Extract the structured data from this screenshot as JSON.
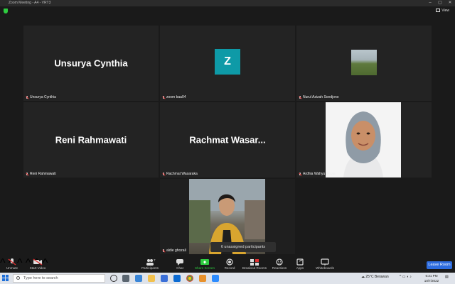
{
  "window": {
    "title": "Zoom Meeting - A4 - VRT3"
  },
  "view_label": "View",
  "tiles": [
    {
      "big_name": "Unsurya Cynthia",
      "label": "Unsurya Cynthia"
    },
    {
      "avatar_letter": "Z",
      "label": "zoom baa04"
    },
    {
      "label": "Nurul Azizah Soedjono"
    },
    {
      "big_name": "Reni Rahmawati",
      "label": "Reni Rahmawati"
    },
    {
      "big_name": "Rachmat  Wasar...",
      "label": "Rachmat Wasaraka"
    },
    {
      "label": "Ardhia Wahyu Septa"
    },
    {
      "label": "aldie ghozali"
    }
  ],
  "unassigned": "6 unassigned participants",
  "toolbar": {
    "unmute": "Unmute",
    "start_video": "Start Video",
    "participants": "Participants",
    "participants_count": "7",
    "chat": "Chat",
    "share_screen": "Share Screen",
    "record": "Record",
    "breakout_rooms": "Breakout Rooms",
    "reactions": "Reactions",
    "apps": "Apps",
    "whiteboards": "Whiteboards",
    "leave": "Leave Room"
  },
  "taskbar": {
    "search_placeholder": "Type here to search",
    "weather": "25°C  Berawan",
    "time": "6:31 PM",
    "date": "10/7/2022"
  },
  "colors": {
    "accent": "#2d6cdf",
    "share_green": "#2ecc40",
    "avatar_teal": "#0e9aa7"
  }
}
